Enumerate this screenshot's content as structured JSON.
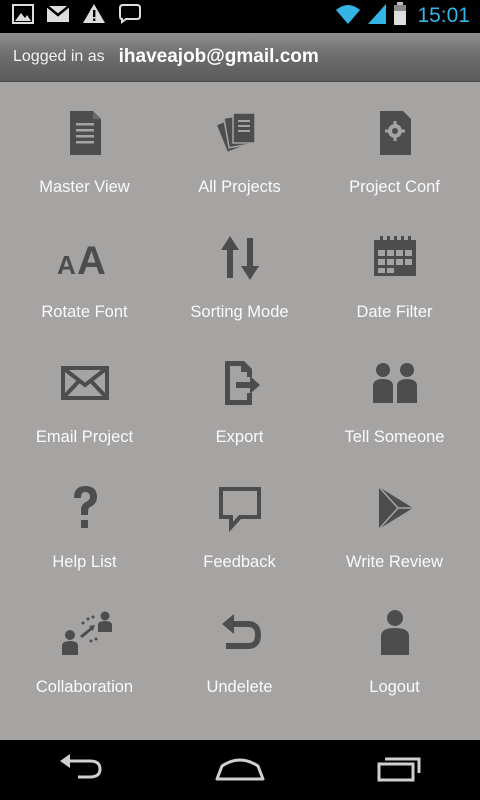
{
  "status_bar": {
    "time": "15:01",
    "accent_color": "#33b5e5",
    "left_icons": [
      "image-icon",
      "gmail-icon",
      "warning-icon",
      "chat-bubble-icon"
    ],
    "right_icons": [
      "wifi-icon",
      "signal-icon",
      "battery-icon"
    ]
  },
  "header": {
    "login_label": "Logged in as",
    "email": "ihaveajob@gmail.com"
  },
  "menu": {
    "items": [
      {
        "label": "Master View",
        "icon": "document-icon"
      },
      {
        "label": "All Projects",
        "icon": "stacked-documents-icon"
      },
      {
        "label": "Project Conf",
        "icon": "document-gear-icon"
      },
      {
        "label": "Rotate Font",
        "icon": "font-size-icon"
      },
      {
        "label": "Sorting Mode",
        "icon": "sort-arrows-icon"
      },
      {
        "label": "Date Filter",
        "icon": "calendar-icon"
      },
      {
        "label": "Email Project",
        "icon": "envelope-icon"
      },
      {
        "label": "Export",
        "icon": "export-icon"
      },
      {
        "label": "Tell Someone",
        "icon": "people-icon"
      },
      {
        "label": "Help List",
        "icon": "question-icon"
      },
      {
        "label": "Feedback",
        "icon": "speech-bubble-icon"
      },
      {
        "label": "Write Review",
        "icon": "play-store-icon"
      },
      {
        "label": "Collaboration",
        "icon": "collaboration-icon"
      },
      {
        "label": "Undelete",
        "icon": "undo-icon"
      },
      {
        "label": "Logout",
        "icon": "person-icon"
      }
    ]
  },
  "nav_bar": {
    "buttons": [
      "back-icon",
      "home-icon",
      "recent-apps-icon"
    ]
  },
  "colors": {
    "background": "#a6a3a3",
    "icon": "#4d4d4d",
    "label": "#fafafa"
  }
}
